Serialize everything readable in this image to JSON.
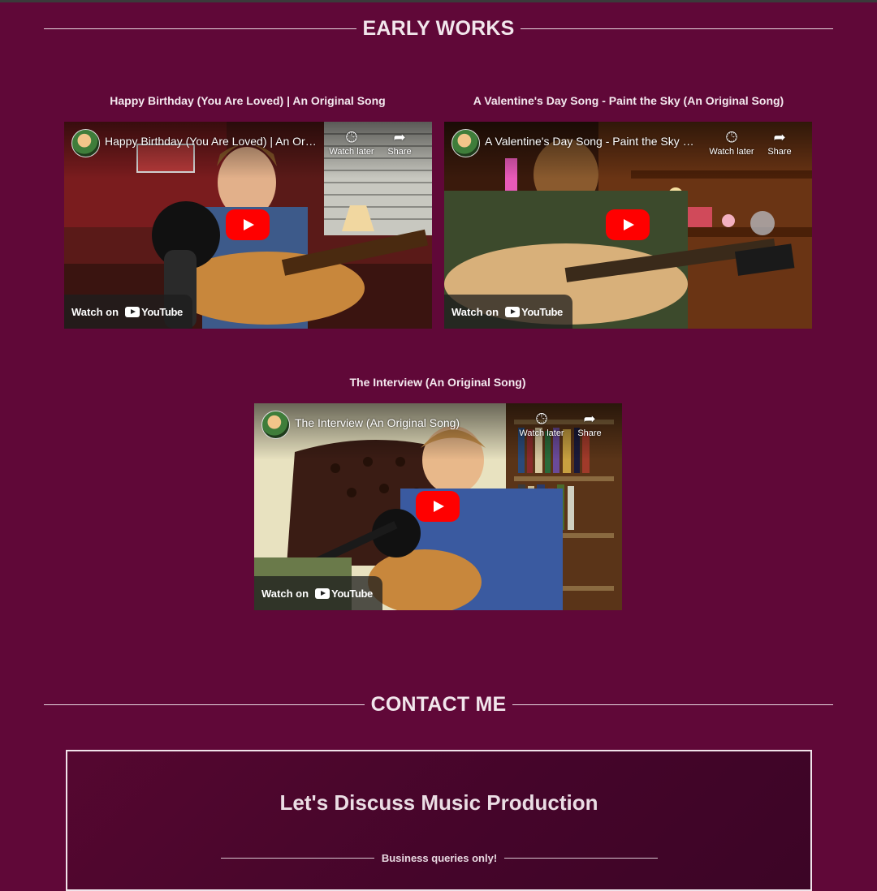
{
  "colors": {
    "page_background": "#600838",
    "heading_text": "#f2e6ec",
    "play_button": "#ff0000",
    "contact_border": "#f1e3ea"
  },
  "early_works": {
    "heading": "EARLY WORKS",
    "videos": [
      {
        "caption": "Happy Birthday (You Are Loved) | An Original Song",
        "player_title": "Happy Birthday (You Are Loved) | An Original Song",
        "watch_later": "Watch later",
        "share": "Share",
        "watch_on": "Watch on",
        "youtube": "YouTube"
      },
      {
        "caption": "A Valentine's Day Song - Paint the Sky (An Original Song)",
        "player_title": "A Valentine's Day Song - Paint the Sky (An Original Song)",
        "watch_later": "Watch later",
        "share": "Share",
        "watch_on": "Watch on",
        "youtube": "YouTube"
      },
      {
        "caption": "The Interview (An Original Song)",
        "player_title": "The Interview (An Original Song)",
        "watch_later": "Watch later",
        "share": "Share",
        "watch_on": "Watch on",
        "youtube": "YouTube"
      }
    ]
  },
  "contact": {
    "heading": "CONTACT ME",
    "box_title": "Let's Discuss Music Production",
    "subtitle": "Business queries only!"
  },
  "icons": {
    "clock": "clock-icon",
    "share": "share-arrow-icon",
    "play": "play-icon",
    "youtube": "youtube-logo"
  }
}
